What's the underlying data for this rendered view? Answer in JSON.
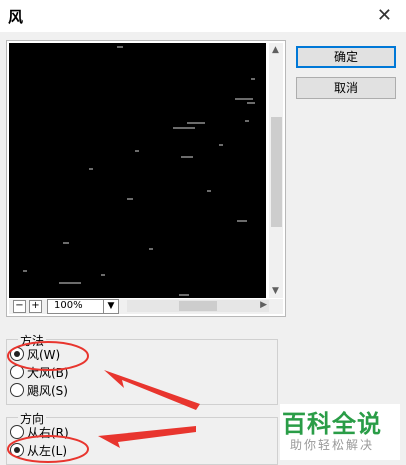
{
  "window": {
    "title": "风",
    "close_glyph": "✕"
  },
  "preview": {
    "zoom_out_glyph": "−",
    "zoom_in_glyph": "+",
    "zoom_value": "100%"
  },
  "buttons": {
    "ok": "确定",
    "cancel": "取消"
  },
  "method": {
    "label": "方法",
    "options": [
      {
        "label": "风(W)",
        "checked": true
      },
      {
        "label": "大风(B)",
        "checked": false
      },
      {
        "label": "飓风(S)",
        "checked": false
      }
    ]
  },
  "direction": {
    "label": "方向",
    "options": [
      {
        "label": "从右(R)",
        "checked": false
      },
      {
        "label": "从左(L)",
        "checked": true
      }
    ]
  },
  "watermark": {
    "main": "百科全说",
    "sub": "助你轻松解决"
  },
  "colors": {
    "annotation": "#e8352e",
    "watermark_green": "#2a9d47"
  }
}
